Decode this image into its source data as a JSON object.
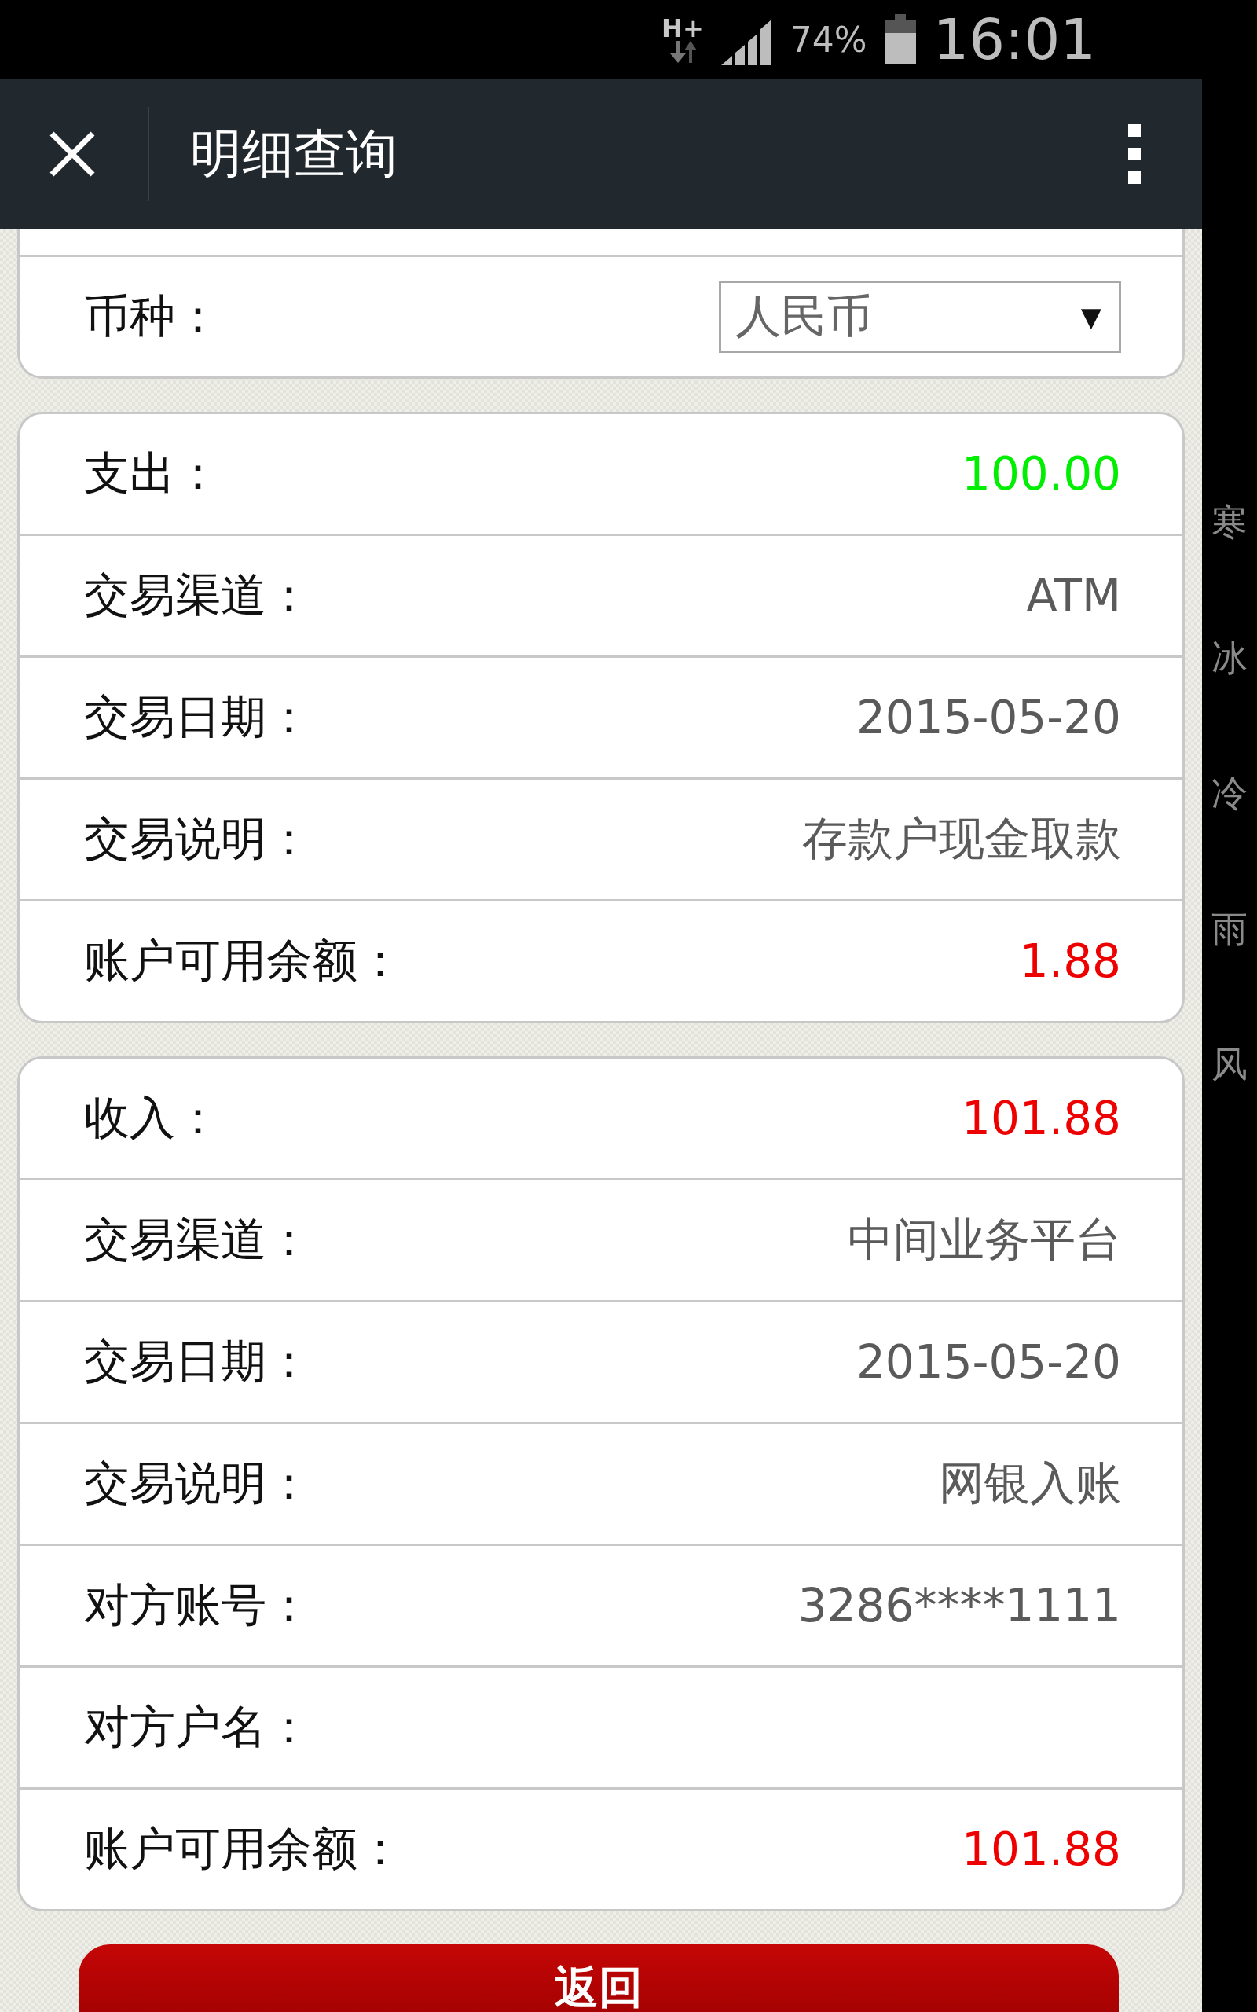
{
  "status_bar": {
    "network": "H+",
    "battery_text": "74%",
    "time": "16:01"
  },
  "header": {
    "title": "明细查询"
  },
  "currency": {
    "label": "币种：",
    "value": "人民币",
    "arrow": "▼"
  },
  "records": [
    {
      "rows": [
        {
          "label": "支出：",
          "value": "100.00",
          "color": "#00ee00"
        },
        {
          "label": "交易渠道：",
          "value": "ATM"
        },
        {
          "label": "交易日期：",
          "value": "2015-05-20"
        },
        {
          "label": "交易说明：",
          "value": "存款户现金取款"
        },
        {
          "label": "账户可用余额：",
          "value": "1.88",
          "color": "#ee0000"
        }
      ]
    },
    {
      "rows": [
        {
          "label": "收入：",
          "value": "101.88",
          "color": "#ee0000"
        },
        {
          "label": "交易渠道：",
          "value": "中间业务平台"
        },
        {
          "label": "交易日期：",
          "value": "2015-05-20"
        },
        {
          "label": "交易说明：",
          "value": "网银入账"
        },
        {
          "label": "对方账号：",
          "value": "3286****1111"
        },
        {
          "label": "对方户名："
        },
        {
          "label": "账户可用余额：",
          "value": "101.88",
          "color": "#ee0000"
        }
      ]
    }
  ],
  "back_button": "返回",
  "side_text": "寒冰冷雨风"
}
